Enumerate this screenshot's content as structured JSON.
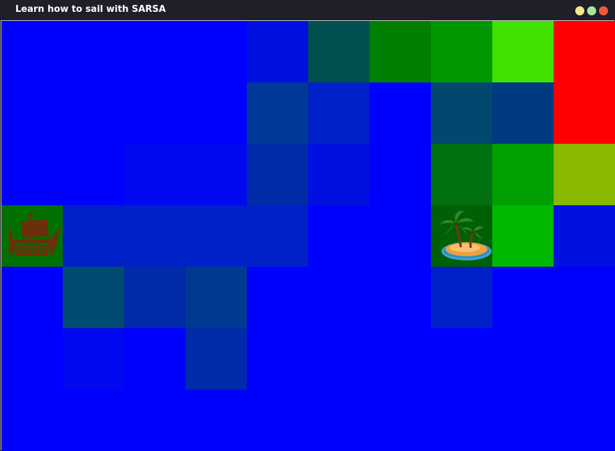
{
  "window": {
    "title": "Learn how to sail with SARSA",
    "controls": [
      {
        "name": "minimize",
        "color": "#f7e685"
      },
      {
        "name": "maximize",
        "color": "#a8e6a0"
      },
      {
        "name": "close",
        "color": "#f05a3c"
      }
    ]
  },
  "grid": {
    "rows": 7,
    "cols": 10,
    "default_color": "#0000ff",
    "cells": [
      [
        "#0000ff",
        "#0000ff",
        "#0000ff",
        "#0000ff",
        "#0010e0",
        "#005050",
        "#008000",
        "#009800",
        "#40e000",
        "#ff0000"
      ],
      [
        "#0000ff",
        "#0000ff",
        "#0000ff",
        "#0000ff",
        "#003a98",
        "#0020c8",
        "#0000ff",
        "#004870",
        "#003a80",
        "#ff0000"
      ],
      [
        "#0000ff",
        "#0000ff",
        "#0008f0",
        "#0008f0",
        "#002aa8",
        "#0010e0",
        "#0000ff",
        "#007010",
        "#00a000",
        "#88b800"
      ],
      [
        "#007000",
        "#0020c8",
        "#0020c8",
        "#0020c8",
        "#0020c8",
        "#0000ff",
        "#0000ff",
        "#006008",
        "#00b800",
        "#0010e0"
      ],
      [
        "#0000ff",
        "#004c70",
        "#002aa8",
        "#003a90",
        "#0000ff",
        "#0000ff",
        "#0000ff",
        "#0020c8",
        "#0000ff",
        "#0000ff"
      ],
      [
        "#0000ff",
        "#0008f0",
        "#0000ff",
        "#002aa8",
        "#0000ff",
        "#0000ff",
        "#0000ff",
        "#0000ff",
        "#0000ff",
        "#0000ff"
      ],
      [
        "#0000ff",
        "#0000ff",
        "#0000ff",
        "#0000ff",
        "#0000ff",
        "#0000ff",
        "#0000ff",
        "#0000ff",
        "#0000ff",
        "#0000ff"
      ]
    ],
    "agent": {
      "icon": "viking-ship-icon",
      "row": 3,
      "col": 0,
      "color": "#6b2f0a"
    },
    "goal": {
      "icon": "palm-island-icon",
      "row": 3,
      "col": 7
    }
  }
}
